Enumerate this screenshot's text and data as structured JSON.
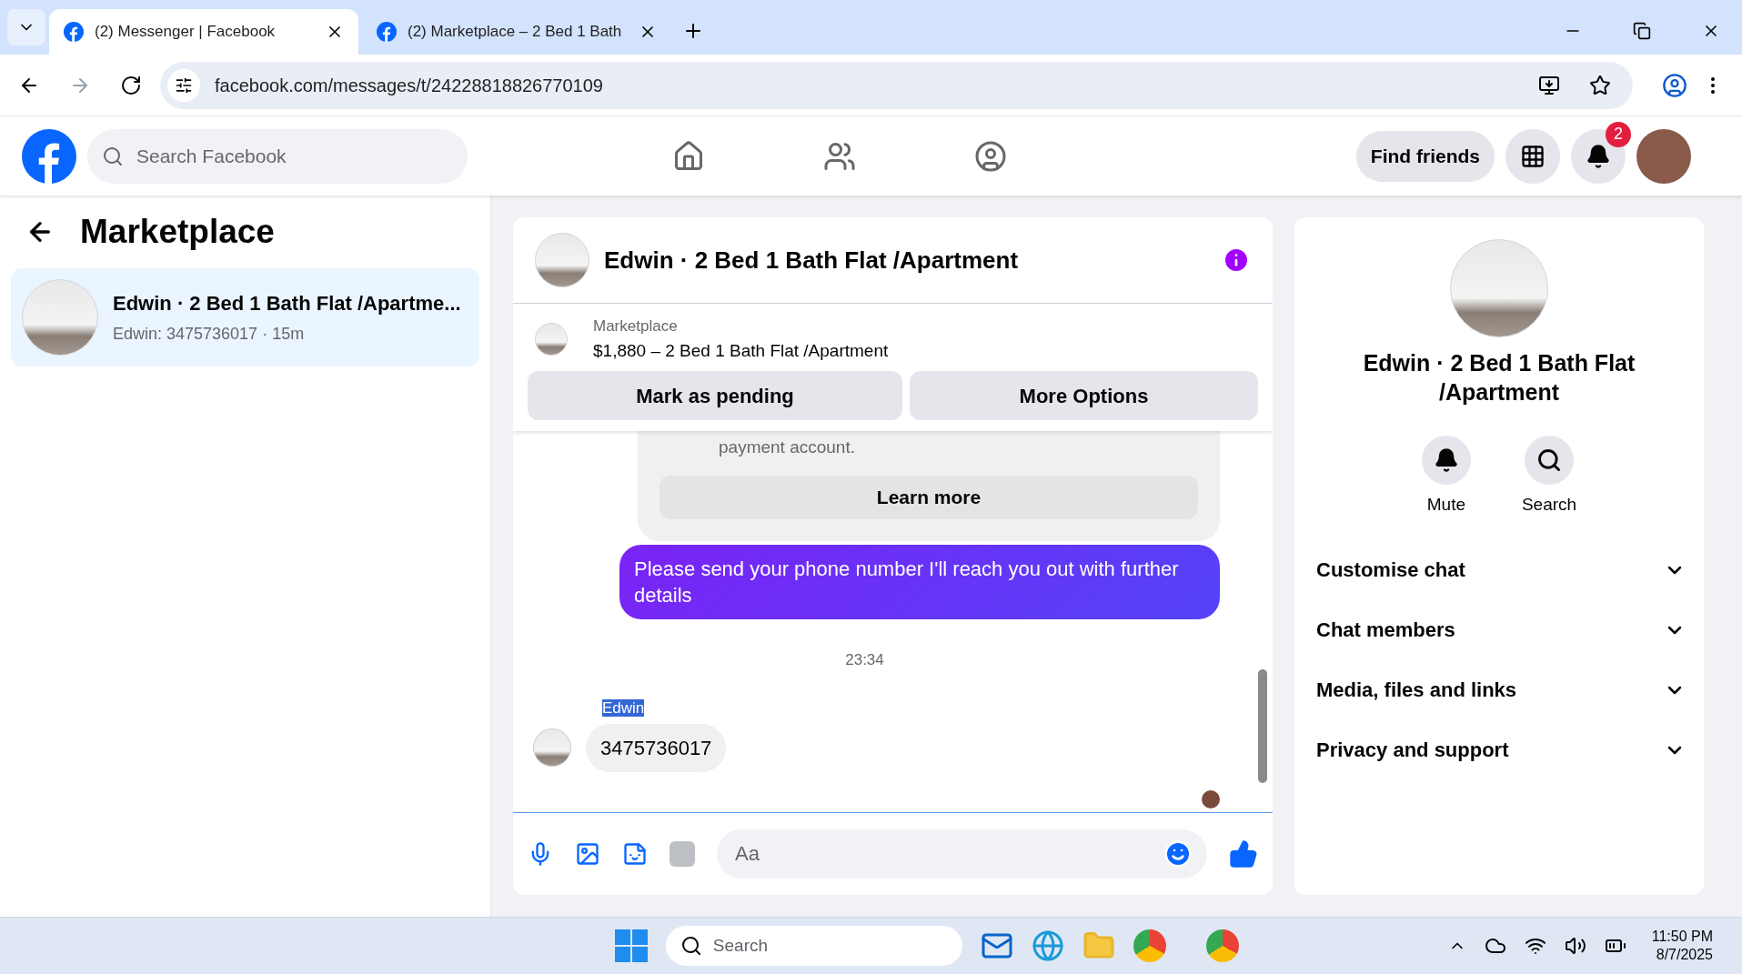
{
  "browser": {
    "tabs": [
      {
        "title": "(2) Messenger | Facebook",
        "selected": true
      },
      {
        "title": "(2) Marketplace – 2 Bed 1 Bath",
        "selected": false
      }
    ],
    "url": "facebook.com/messages/t/24228818826770109"
  },
  "nav": {
    "search_placeholder": "Search Facebook",
    "find_friends": "Find friends",
    "notification_badge": "2"
  },
  "sidebar": {
    "title": "Marketplace",
    "conversations": [
      {
        "title": "Edwin · 2 Bed 1 Bath Flat /Apartme...",
        "preview": "Edwin: 3475736017 · 15m",
        "selected": true
      }
    ]
  },
  "chat": {
    "title": "Edwin · 2 Bed 1 Bath Flat /Apartment",
    "listing": {
      "label": "Marketplace",
      "title": "$1,880 – 2 Bed 1 Bath Flat /Apartment"
    },
    "actions": [
      "Mark as pending",
      "More Options"
    ],
    "messages": [
      {
        "kind": "notice",
        "text": "payment account.",
        "button": "Learn more"
      },
      {
        "kind": "outgoing",
        "text": "Please send your phone number  I'll reach you out with further details"
      },
      {
        "kind": "timestamp",
        "text": "23:34"
      },
      {
        "kind": "incoming",
        "sender": "Edwin",
        "sender_highlighted": true,
        "text": "3475736017"
      }
    ],
    "composer_placeholder": "Aa"
  },
  "info": {
    "title": "Edwin · 2 Bed 1 Bath Flat /Apartment",
    "actions": [
      {
        "kind": "bell",
        "label": "Mute"
      },
      {
        "kind": "search",
        "label": "Search"
      }
    ],
    "sections": [
      {
        "label": "Customise chat",
        "expanded": false
      },
      {
        "label": "Chat members",
        "expanded": false
      },
      {
        "label": "Media, files and links",
        "expanded": false
      },
      {
        "label": "Privacy and support",
        "expanded": false
      }
    ]
  },
  "taskbar": {
    "search_placeholder": "Search",
    "time": "11:50 PM",
    "date": "8/7/2025"
  }
}
